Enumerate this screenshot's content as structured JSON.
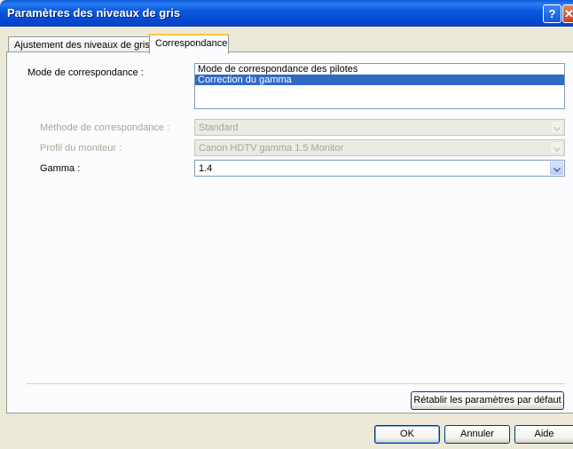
{
  "window": {
    "title": "Paramètres des niveaux de gris"
  },
  "titlebar": {
    "help_glyph": "?",
    "close_glyph": "✕"
  },
  "tabs": [
    {
      "label": "Ajustement des niveaux de gris"
    },
    {
      "label": "Correspondance"
    }
  ],
  "matching": {
    "mode_label": "Mode de correspondance :",
    "mode_options": [
      "Mode de correspondance des pilotes",
      "Correction du gamma"
    ],
    "mode_selected_index": 1,
    "method_label": "Méthode de correspondance :",
    "method_value": "Standard",
    "profile_label": "Profil du moniteur :",
    "profile_value": "Canon HDTV gamma 1.5 Monitor",
    "gamma_label": "Gamma :",
    "gamma_value": "1.4"
  },
  "buttons": {
    "reset": "Rétablir les paramètres par défaut",
    "ok": "OK",
    "cancel": "Annuler",
    "help": "Aide"
  },
  "colors": {
    "titlebar": "#0a5ae0",
    "selection": "#316ac5",
    "dialog_bg": "#ece9d8"
  }
}
